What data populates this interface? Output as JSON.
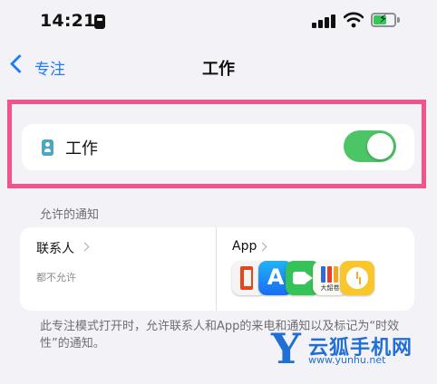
{
  "status_bar": {
    "time": "14:21",
    "icons": [
      "focus-mode-icon",
      "cellular-signal-icon",
      "wifi-icon",
      "battery-charging-icon"
    ]
  },
  "nav": {
    "back_label": "专注",
    "title": "工作"
  },
  "focus_row": {
    "label": "工作",
    "toggle_on": true,
    "toggle_color": "#4cc566"
  },
  "allowed_section": {
    "header": "允许的通知",
    "people": {
      "title": "联系人",
      "subtitle": "都不允许"
    },
    "apps": {
      "title": "App",
      "icons": [
        "office-app-icon",
        "app-store-icon",
        "facetime-icon",
        "books-app-icon",
        "clock-app-icon"
      ],
      "books_icon_label": "大韶卷"
    }
  },
  "footer": "此专注模式打开时，允许联系人和App的来电和通知以及标记为“时效性”的通知。",
  "watermark": {
    "letter": "Y",
    "name": "云狐手机网",
    "url": "www.yunhu.net"
  },
  "colors": {
    "accent": "#1f79ff",
    "highlight": "#f0548a",
    "watermark": "#1f6fd6"
  }
}
